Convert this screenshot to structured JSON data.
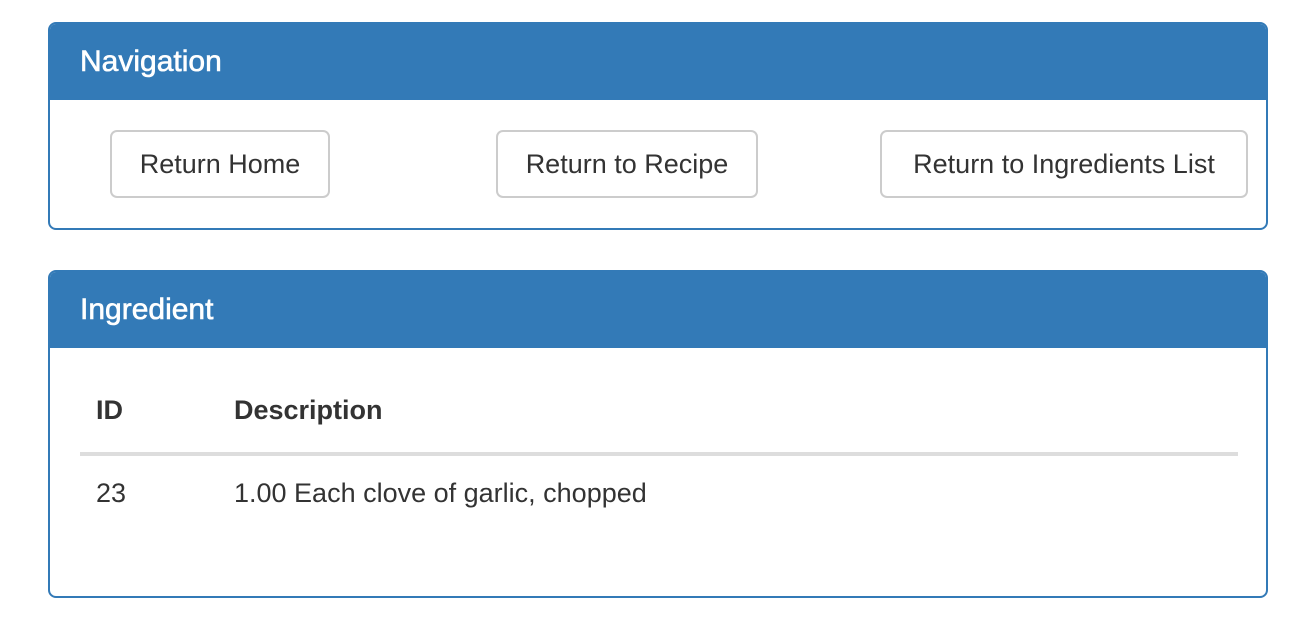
{
  "navigation": {
    "title": "Navigation",
    "buttons": {
      "home": "Return Home",
      "recipe": "Return to Recipe",
      "ingredients_list": "Return to Ingredients List"
    }
  },
  "ingredient": {
    "title": "Ingredient",
    "table": {
      "headers": [
        "ID",
        "Description"
      ],
      "rows": [
        [
          "23",
          "1.00 Each clove of garlic, chopped"
        ]
      ]
    }
  },
  "colors": {
    "primary": "#337ab7",
    "button_border": "#cccccc",
    "table_rule": "#dddddd",
    "text": "#333333"
  }
}
